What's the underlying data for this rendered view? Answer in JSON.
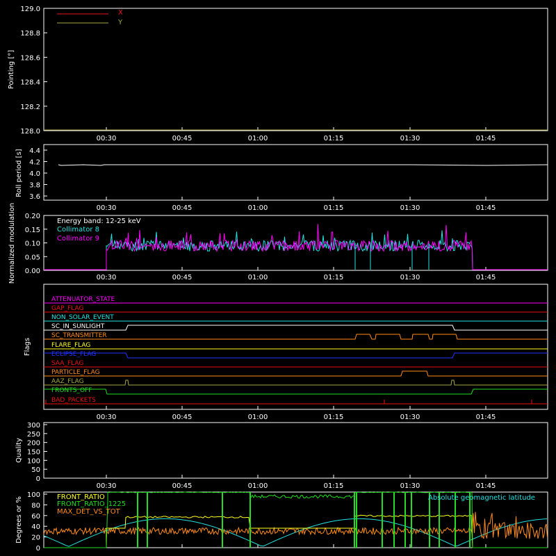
{
  "colors": {
    "bg": "#000000",
    "axis": "#ffffff",
    "x": "#e8161d",
    "y": "#a8a844",
    "cyan": "#22e3e3",
    "magenta": "#ff00ff",
    "green": "#22dd22",
    "yellow": "#ffff22",
    "orange": "#ff8c1a",
    "blue": "#2233ff",
    "red": "#ee1111"
  },
  "time_ticks": [
    "00:30",
    "00:45",
    "01:00",
    "01:15",
    "01:30",
    "01:45"
  ],
  "chart_data": [
    {
      "type": "line",
      "ylabel": "Pointing [°]",
      "ylim": [
        128.0,
        129.0
      ],
      "yticks": [
        "129.0",
        "128.8",
        "128.6",
        "128.4",
        "128.2",
        "128.0"
      ],
      "series": [
        {
          "name": "X",
          "values": []
        },
        {
          "name": "Y",
          "values": []
        }
      ]
    },
    {
      "type": "line",
      "ylabel": "Roll period [s]",
      "ylim": [
        3.5,
        4.5
      ],
      "yticks": [
        "4.4",
        "4.2",
        "4.0",
        "3.8",
        "3.6"
      ],
      "series": [
        {
          "values": [
            4.13,
            4.13,
            4.13,
            4.13,
            4.13,
            4.13,
            4.13
          ]
        }
      ]
    },
    {
      "type": "line",
      "ylabel": "Normalized modulation",
      "ylim": [
        0,
        0.2
      ],
      "yticks": [
        "0.20",
        "0.15",
        "0.10",
        "0.05",
        "0.00"
      ],
      "annotation": "Energy band: 12-25 keV",
      "series": [
        {
          "name": "Collimator 8"
        },
        {
          "name": "Collimator 9"
        }
      ]
    },
    {
      "type": "line",
      "ylabel": "Flags",
      "flags": [
        "ATTENUATOR_STATE",
        "GAP_FLAG",
        "NON_SOLAR_EVENT",
        "SC_IN_SUNLIGHT",
        "SC_TRANSMITTER",
        "FLARE_FLAG",
        "ECLIPSE_FLAG",
        "SAA_FLAG",
        "PARTICLE_FLAG",
        "AAZ_FLAG",
        "FRONTS_OFF",
        "BAD_PACKETS"
      ]
    },
    {
      "type": "line",
      "ylabel": "Quality",
      "ylim": [
        0,
        300
      ],
      "yticks": [
        "300",
        "250",
        "200",
        "150",
        "100",
        "50",
        "0"
      ]
    },
    {
      "type": "line",
      "ylabel": "Degrees or %",
      "ylim": [
        0,
        100
      ],
      "yticks": [
        "100",
        "80",
        "60",
        "40",
        "20",
        "0"
      ],
      "series": [
        {
          "name": "FRONT_RATIO"
        },
        {
          "name": "FRONT_RATIO_1225"
        },
        {
          "name": "MAX_DET_VS_TOT"
        },
        {
          "name": "Absolute geomagnetic latitude"
        }
      ]
    }
  ]
}
